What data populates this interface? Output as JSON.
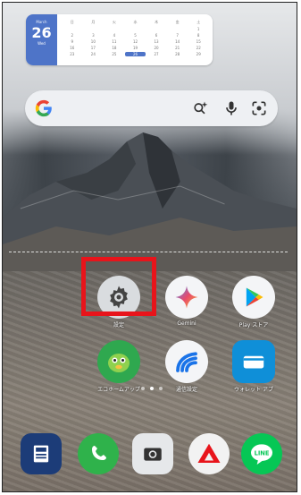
{
  "calendar": {
    "month": "March",
    "day": "26",
    "weekday": "Wed",
    "weekdays": [
      "日",
      "月",
      "火",
      "水",
      "木",
      "金",
      "土"
    ],
    "dates": [
      "",
      "",
      "",
      "",
      "",
      "",
      "1",
      "2",
      "3",
      "4",
      "5",
      "6",
      "7",
      "8",
      "9",
      "10",
      "11",
      "12",
      "13",
      "14",
      "15",
      "16",
      "17",
      "18",
      "19",
      "20",
      "21",
      "22",
      "23",
      "24",
      "25",
      "26",
      "27",
      "28",
      "29"
    ],
    "today": "26"
  },
  "search": {
    "google_icon": "google-g-icon",
    "icons": [
      "ai-search-icon",
      "microphone-icon",
      "lens-camera-icon"
    ]
  },
  "apps": {
    "row1": [
      {
        "name": "settings",
        "label": "設定",
        "icon": "gear-icon"
      },
      {
        "name": "gemini",
        "label": "Gemini",
        "icon": "gemini-sparkle-icon"
      },
      {
        "name": "play-store",
        "label": "Play ストア",
        "icon": "play-triangle-icon"
      }
    ],
    "row2": [
      {
        "name": "app-green-character",
        "label": "エコホームアップ",
        "icon": "green-character-icon"
      },
      {
        "name": "app-wifi-blue",
        "label": "通信設定",
        "icon": "signal-wave-icon"
      },
      {
        "name": "app-wallet",
        "label": "ウォレット アプ",
        "icon": "wallet-card-icon"
      }
    ]
  },
  "dock": [
    {
      "name": "dock-app-news",
      "icon": "news-icon"
    },
    {
      "name": "dock-phone",
      "icon": "phone-icon"
    },
    {
      "name": "dock-camera",
      "icon": "camera-icon"
    },
    {
      "name": "dock-app-red",
      "icon": "red-triangle-icon"
    },
    {
      "name": "dock-line",
      "label": "LINE",
      "icon": "line-icon"
    }
  ],
  "colors": {
    "highlight": "#e8141b",
    "calendar_accent": "#4e74c8"
  }
}
